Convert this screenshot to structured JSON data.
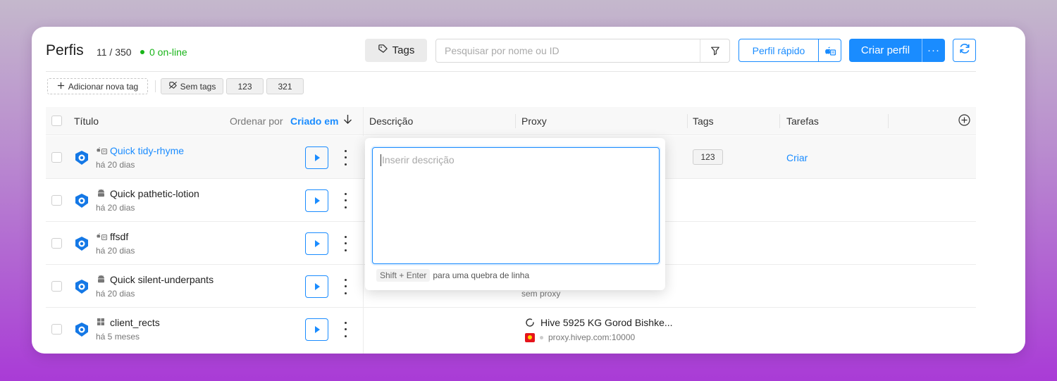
{
  "header": {
    "title": "Perfis",
    "count": "11 / 350",
    "online": "0 on-line",
    "tags_button": "Tags",
    "search_placeholder": "Pesquisar por nome ou ID",
    "quick_profile": "Perfil rápido",
    "create_profile": "Criar perfil",
    "more": "···"
  },
  "tag_bar": {
    "add_tag": "Adicionar nova tag",
    "no_tags": "Sem tags",
    "tags": [
      "123",
      "321"
    ]
  },
  "table": {
    "columns": {
      "title": "Título",
      "order_by": "Ordenar por",
      "order_field": "Criado em",
      "description": "Descrição",
      "proxy": "Proxy",
      "tags": "Tags",
      "tasks": "Tarefas"
    },
    "rows": [
      {
        "name": "Quick tidy-rhyme",
        "time": "há 20 dias",
        "os_icon": "mac-android-icon",
        "tag": "123",
        "task": "Criar"
      },
      {
        "name": "Quick pathetic-lotion",
        "time": "há 20 dias",
        "os_icon": "android-icon"
      },
      {
        "name": "ffsdf",
        "time": "há 20 dias",
        "os_icon": "mac-android-icon"
      },
      {
        "name": "Quick silent-underpants",
        "time": "há 20 dias",
        "os_icon": "android-icon",
        "proxy_note": "sem proxy"
      },
      {
        "name": "client_rects",
        "time": "há 5 meses",
        "os_icon": "windows-icon",
        "proxy_name": "Hive 5925 KG Gorod Bishke...",
        "proxy_host": "proxy.hivep.com:10000"
      }
    ]
  },
  "description_popup": {
    "placeholder": "Inserir descrição",
    "shortcut": "Shift + Enter",
    "shortcut_hint": "para uma quebra de linha"
  },
  "colors": {
    "accent": "#1a8cff",
    "online": "#18b418"
  }
}
